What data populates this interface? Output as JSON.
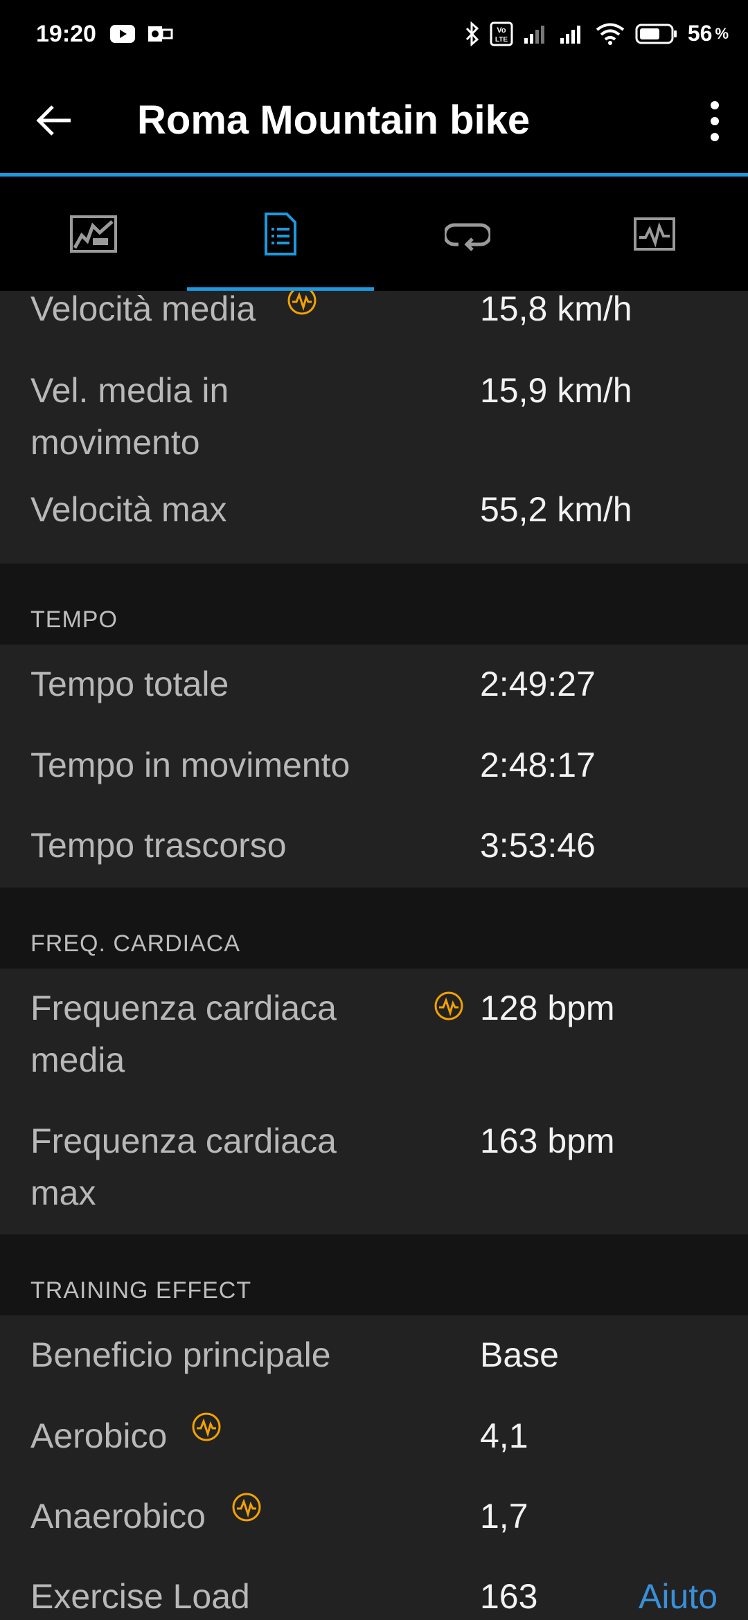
{
  "status_bar": {
    "time": "19:20",
    "battery": "56",
    "battery_unit": "%"
  },
  "app_bar": {
    "title": "Roma Mountain bike"
  },
  "tabs": [
    {
      "name": "map-chart-icon",
      "active": false
    },
    {
      "name": "list-document-icon",
      "active": true
    },
    {
      "name": "laps-loop-icon",
      "active": false
    },
    {
      "name": "graph-icon",
      "active": false
    }
  ],
  "speed": {
    "avg_label": "Velocità media",
    "avg_value": "15,8 km/h",
    "moving_avg_label": "Vel. media in movimento",
    "moving_avg_value": "15,9 km/h",
    "max_label": "Velocità max",
    "max_value": "55,2 km/h"
  },
  "time_section": {
    "header": "TEMPO",
    "total_label": "Tempo totale",
    "total_value": "2:49:27",
    "moving_label": "Tempo in movimento",
    "moving_value": "2:48:17",
    "elapsed_label": "Tempo trascorso",
    "elapsed_value": "3:53:46"
  },
  "hr_section": {
    "header": "FREQ. CARDIACA",
    "avg_label": "Frequenza cardiaca media",
    "avg_value": "128 bpm",
    "max_label": "Frequenza cardiaca max",
    "max_value": "163 bpm"
  },
  "training_section": {
    "header": "TRAINING EFFECT",
    "primary_label": "Beneficio principale",
    "primary_value": "Base",
    "aerobic_label": "Aerobico",
    "aerobic_value": "4,1",
    "anaerobic_label": "Anaerobico",
    "anaerobic_value": "1,7",
    "load_label": "Exercise Load",
    "load_value": "163",
    "help_label": "Aiuto"
  },
  "colors": {
    "accent": "#1a9ae0",
    "badge": "#f2a200",
    "link": "#3a8fd9"
  }
}
